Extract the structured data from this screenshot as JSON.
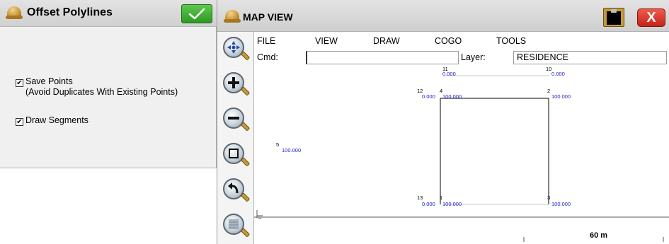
{
  "left_panel": {
    "title": "Offset Polylines",
    "ok_icon": "checkmark-icon",
    "options": [
      {
        "label_line1": "Save Points",
        "label_line2": "(Avoid Duplicates With Existing Points)",
        "checked": true
      },
      {
        "label_line1": "Draw Segments",
        "label_line2": "",
        "checked": true
      }
    ]
  },
  "map_window": {
    "title": "MAP VIEW",
    "close_label": "X",
    "menu": [
      "FILE",
      "VIEW",
      "DRAW",
      "COGO",
      "TOOLS"
    ],
    "cmd_label": "Cmd:",
    "cmd_value": "",
    "layer_label": "Layer:",
    "layer_value": "RESIDENCE",
    "tools": [
      "pan-icon",
      "zoom-in-icon",
      "zoom-out-icon",
      "zoom-window-icon",
      "zoom-previous-icon",
      "zoom-extents-icon"
    ],
    "scale_label": "60 m",
    "accent_color": "#2020c8",
    "points": [
      {
        "id": "11",
        "value": "0.000"
      },
      {
        "id": "10",
        "value": "0.000"
      },
      {
        "id": "12",
        "value": "0.000"
      },
      {
        "id": "4",
        "value": "100.000"
      },
      {
        "id": "2",
        "value": "100.000"
      },
      {
        "id": "5",
        "value": "100.000"
      },
      {
        "id": "13",
        "value": "0.000"
      },
      {
        "id": "1",
        "value": "100.000"
      },
      {
        "id": "3",
        "value": "100.000"
      }
    ]
  }
}
